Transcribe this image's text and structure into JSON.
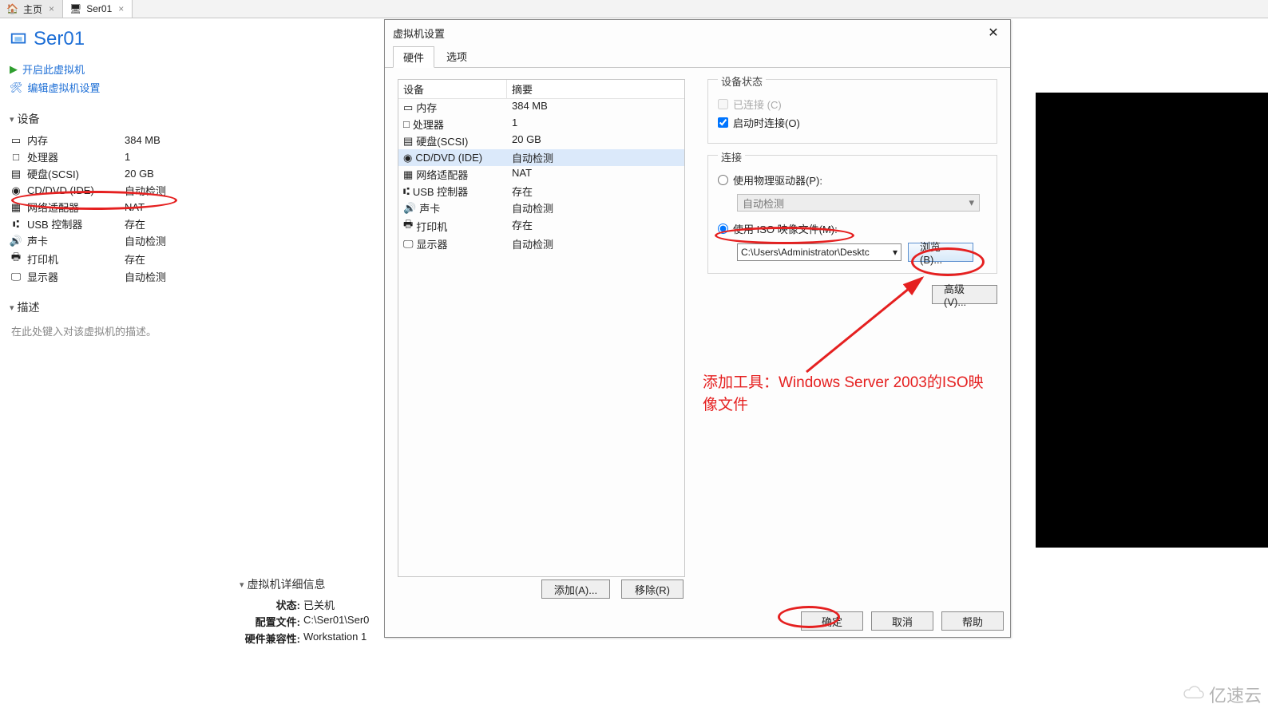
{
  "tabs": {
    "home": "主页",
    "vm": "Ser01"
  },
  "vm": {
    "title": "Ser01",
    "actions": {
      "power_on": "开启此虚拟机",
      "edit_settings": "编辑虚拟机设置"
    },
    "devices_header": "设备",
    "devices": [
      {
        "name": "内存",
        "value": "384 MB",
        "icon": "memory"
      },
      {
        "name": "处理器",
        "value": "1",
        "icon": "cpu"
      },
      {
        "name": "硬盘(SCSI)",
        "value": "20 GB",
        "icon": "hdd"
      },
      {
        "name": "CD/DVD (IDE)",
        "value": "自动检测",
        "icon": "cd"
      },
      {
        "name": "网络适配器",
        "value": "NAT",
        "icon": "net"
      },
      {
        "name": "USB 控制器",
        "value": "存在",
        "icon": "usb"
      },
      {
        "name": "声卡",
        "value": "自动检测",
        "icon": "sound"
      },
      {
        "name": "打印机",
        "value": "存在",
        "icon": "printer"
      },
      {
        "name": "显示器",
        "value": "自动检测",
        "icon": "display"
      }
    ],
    "desc_header": "描述",
    "desc_placeholder": "在此处键入对该虚拟机的描述。",
    "details_header": "虚拟机详细信息",
    "details": {
      "status_k": "状态:",
      "status_v": "已关机",
      "config_k": "配置文件:",
      "config_v": "C:\\Ser01\\Ser0",
      "compat_k": "硬件兼容性:",
      "compat_v": "Workstation 1"
    }
  },
  "dialog": {
    "title": "虚拟机设置",
    "tabs": {
      "hardware": "硬件",
      "options": "选项"
    },
    "hw_cols": {
      "device": "设备",
      "summary": "摘要"
    },
    "hw_rows": [
      {
        "name": "内存",
        "value": "384 MB",
        "icon": "memory"
      },
      {
        "name": "处理器",
        "value": "1",
        "icon": "cpu"
      },
      {
        "name": "硬盘(SCSI)",
        "value": "20 GB",
        "icon": "hdd"
      },
      {
        "name": "CD/DVD (IDE)",
        "value": "自动检测",
        "icon": "cd"
      },
      {
        "name": "网络适配器",
        "value": "NAT",
        "icon": "net"
      },
      {
        "name": "USB 控制器",
        "value": "存在",
        "icon": "usb"
      },
      {
        "name": "声卡",
        "value": "自动检测",
        "icon": "sound"
      },
      {
        "name": "打印机",
        "value": "存在",
        "icon": "printer"
      },
      {
        "name": "显示器",
        "value": "自动检测",
        "icon": "display"
      }
    ],
    "state": {
      "group": "设备状态",
      "connected": "已连接 (C)",
      "connect_on_start": "启动时连接(O)"
    },
    "connect": {
      "group": "连接",
      "physical": "使用物理驱动器(P):",
      "auto_detect": "自动检测",
      "iso": "使用 ISO 映像文件(M):",
      "iso_path": "C:\\Users\\Administrator\\Desktc",
      "browse": "浏览(B)..."
    },
    "advanced": "高级(V)...",
    "add": "添加(A)...",
    "remove": "移除(R)",
    "ok": "确定",
    "cancel": "取消",
    "help": "帮助"
  },
  "annotation": "添加工具：Windows Server 2003的ISO映像文件",
  "watermark": "亿速云"
}
